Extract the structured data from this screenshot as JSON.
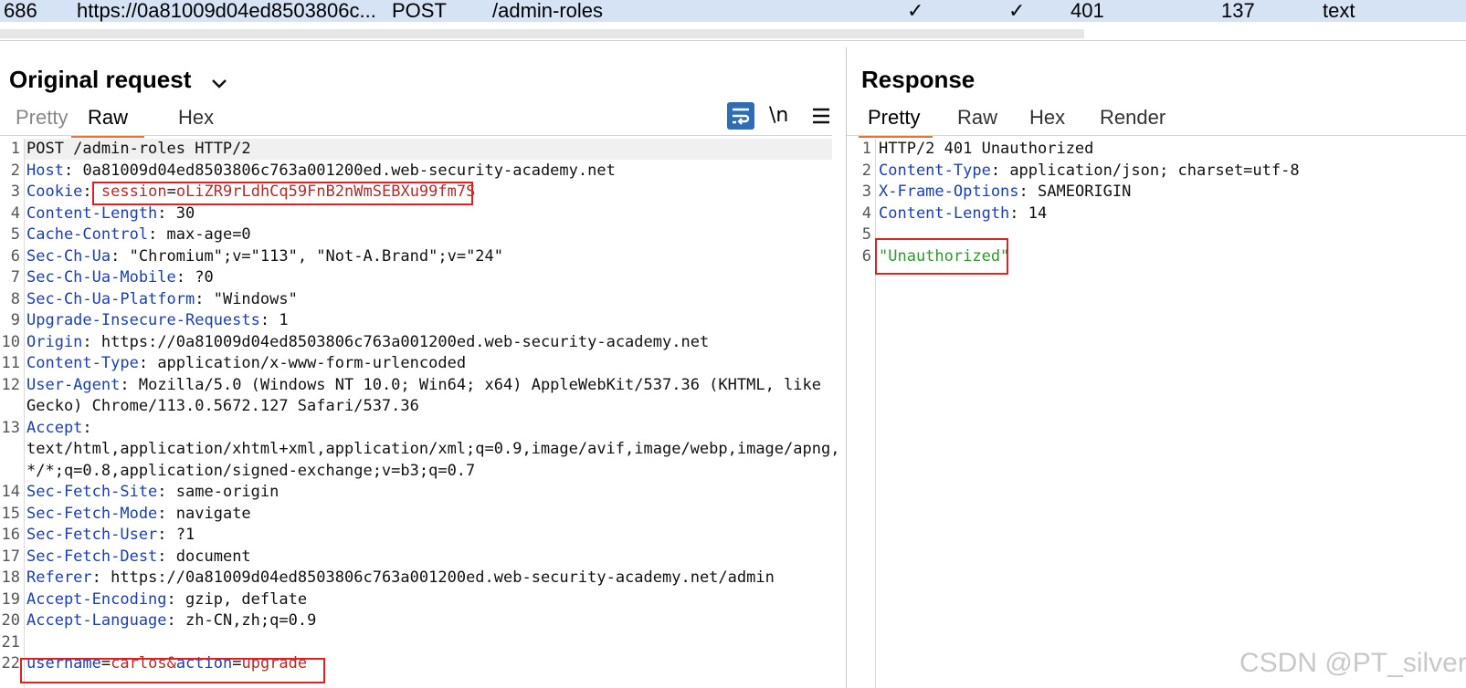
{
  "history_row": {
    "id": "686",
    "url": "https://0a81009d04ed8503806c...",
    "method": "POST",
    "path": "/admin-roles",
    "check1": "✓",
    "check2": "✓",
    "status": "401",
    "length": "137",
    "mime": "text"
  },
  "request": {
    "title": "Original request",
    "tabs": [
      "Pretty",
      "Raw",
      "Hex"
    ],
    "active_tab": "Raw",
    "tools": {
      "newline_label": "\\n"
    },
    "lines": [
      {
        "n": "1",
        "text": "POST /admin-roles HTTP/2"
      },
      {
        "n": "2",
        "key": "Host",
        "val": " 0a81009d04ed8503806c763a001200ed.web-security-academy.net"
      },
      {
        "n": "3",
        "key": "Cookie",
        "val": " ",
        "ckey": "session",
        "cval": "oLiZR9rLdhCq59FnB2nWmSEBXu99fm7S"
      },
      {
        "n": "4",
        "key": "Content-Length",
        "val": " 30"
      },
      {
        "n": "5",
        "key": "Cache-Control",
        "val": " max-age=0"
      },
      {
        "n": "6",
        "key": "Sec-Ch-Ua",
        "val": " \"Chromium\";v=\"113\", \"Not-A.Brand\";v=\"24\""
      },
      {
        "n": "7",
        "key": "Sec-Ch-Ua-Mobile",
        "val": " ?0"
      },
      {
        "n": "8",
        "key": "Sec-Ch-Ua-Platform",
        "val": " \"Windows\""
      },
      {
        "n": "9",
        "key": "Upgrade-Insecure-Requests",
        "val": " 1"
      },
      {
        "n": "10",
        "key": "Origin",
        "val": " https://0a81009d04ed8503806c763a001200ed.web-security-academy.net"
      },
      {
        "n": "11",
        "key": "Content-Type",
        "val": " application/x-www-form-urlencoded"
      },
      {
        "n": "12",
        "key": "User-Agent",
        "val": " Mozilla/5.0 (Windows NT 10.0; Win64; x64) AppleWebKit/537.36 (KHTML, like"
      },
      {
        "n": "",
        "text": "Gecko) Chrome/113.0.5672.127 Safari/537.36"
      },
      {
        "n": "13",
        "key": "Accept",
        "val": ""
      },
      {
        "n": "",
        "text": "text/html,application/xhtml+xml,application/xml;q=0.9,image/avif,image/webp,image/apng,"
      },
      {
        "n": "",
        "text": "*/*;q=0.8,application/signed-exchange;v=b3;q=0.7"
      },
      {
        "n": "14",
        "key": "Sec-Fetch-Site",
        "val": " same-origin"
      },
      {
        "n": "15",
        "key": "Sec-Fetch-Mode",
        "val": " navigate"
      },
      {
        "n": "16",
        "key": "Sec-Fetch-User",
        "val": " ?1"
      },
      {
        "n": "17",
        "key": "Sec-Fetch-Dest",
        "val": " document"
      },
      {
        "n": "18",
        "key": "Referer",
        "val": " https://0a81009d04ed8503806c763a001200ed.web-security-academy.net/admin"
      },
      {
        "n": "19",
        "key": "Accept-Encoding",
        "val": " gzip, deflate"
      },
      {
        "n": "20",
        "key": "Accept-Language",
        "val": " zh-CN,zh;q=0.9"
      },
      {
        "n": "21",
        "text": ""
      },
      {
        "n": "22",
        "params": [
          [
            "username",
            "carlos"
          ],
          [
            "action",
            "upgrade"
          ]
        ]
      }
    ]
  },
  "response": {
    "title": "Response",
    "tabs": [
      "Pretty",
      "Raw",
      "Hex",
      "Render"
    ],
    "active_tab": "Pretty",
    "lines": [
      {
        "n": "1",
        "text": "HTTP/2 401 Unauthorized"
      },
      {
        "n": "2",
        "key": "Content-Type",
        "val": " application/json; charset=utf-8"
      },
      {
        "n": "3",
        "key": "X-Frame-Options",
        "val": " SAMEORIGIN"
      },
      {
        "n": "4",
        "key": "Content-Length",
        "val": " 14"
      },
      {
        "n": "5",
        "text": ""
      },
      {
        "n": "6",
        "json": "\"Unauthorized\""
      }
    ]
  },
  "watermark": "CSDN @PT_silver",
  "colors": {
    "accent": "#e8723c",
    "key": "#1b3fb0",
    "value_red": "#b22b2b",
    "json_green": "#2a9a2a",
    "highlight": "#e02020"
  }
}
